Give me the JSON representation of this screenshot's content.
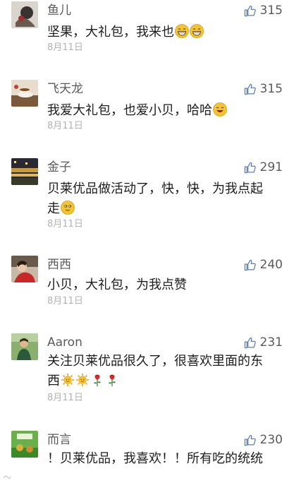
{
  "comments": [
    {
      "name": "鱼儿",
      "likes": "315",
      "lines": [
        "坚果，大礼包，我来也"
      ],
      "emojis": [
        "grin-emoji",
        "grin-emoji"
      ],
      "date": "8月11日"
    },
    {
      "name": "飞天龙",
      "likes": "315",
      "lines": [
        "我爱大礼包，也爱小贝，哈哈"
      ],
      "emojis": [
        "smile-emoji"
      ],
      "date": "8月11日"
    },
    {
      "name": "金子",
      "likes": "291",
      "lines": [
        "贝莱优品做活动了，快，快，为我点起",
        "走"
      ],
      "emojis": [
        "smirk-emoji"
      ],
      "date": "8月11日"
    },
    {
      "name": "西西",
      "likes": "240",
      "lines": [
        "小贝，大礼包，为我点赞"
      ],
      "emojis": [],
      "date": "8月11日"
    },
    {
      "name": "Aaron",
      "likes": "231",
      "lines": [
        "关注贝莱优品很久了，很喜欢里面的东",
        "西"
      ],
      "emojis": [
        "sun-emoji",
        "sun-emoji",
        "rose-emoji",
        "rose-emoji"
      ],
      "date": "8月11日"
    },
    {
      "name": "而言",
      "likes": "230",
      "lines": [
        "！贝莱优品，我喜欢！！所有吃的统统"
      ],
      "emojis": [],
      "date": ""
    }
  ],
  "colors": {
    "like_icon": "#5b7fb8",
    "name": "#5a5a5a",
    "date": "#b3b3b3"
  }
}
